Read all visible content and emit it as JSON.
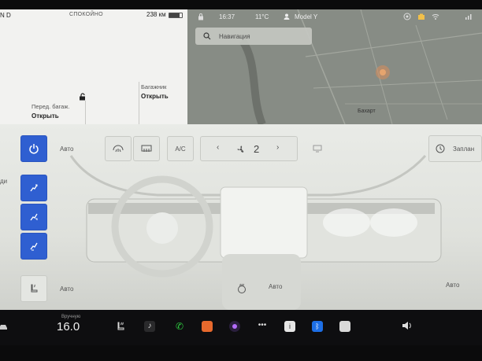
{
  "car": {
    "gear": "N D",
    "mode": "СПОКОЙНО",
    "range": "238 км",
    "battery_level": 0.8,
    "frunk_label": "Перед. багаж.",
    "frunk_value": "Открыть",
    "trunk_label": "Багажник",
    "trunk_value": "Открыть"
  },
  "status": {
    "time": "16:37",
    "temperature": "11°C",
    "profile": "Model Y"
  },
  "navigation": {
    "placeholder": "Навигация",
    "map_label": "Бахарт"
  },
  "climate": {
    "power_icon": "power-icon",
    "auto_label": "Авто",
    "ac_label": "A/C",
    "fan_speed": "2",
    "schedule_label": "Заплан",
    "left_side_label": "ди",
    "seat_auto_left": "Авто",
    "seat_auto_center": "Авто",
    "seat_auto_right": "Авто",
    "colors": {
      "accent": "#2f5fd1",
      "panel": "#e9ebe7"
    }
  },
  "taskbar": {
    "temp_mode": "Вручную",
    "temp_value": "16.0",
    "icons": [
      "car-icon",
      "seat-heat-icon",
      "music-icon",
      "phone-icon",
      "audio-icon",
      "camera-icon",
      "more-icon",
      "info-icon",
      "bluetooth-icon",
      "notes-icon",
      "volume-icon"
    ]
  }
}
